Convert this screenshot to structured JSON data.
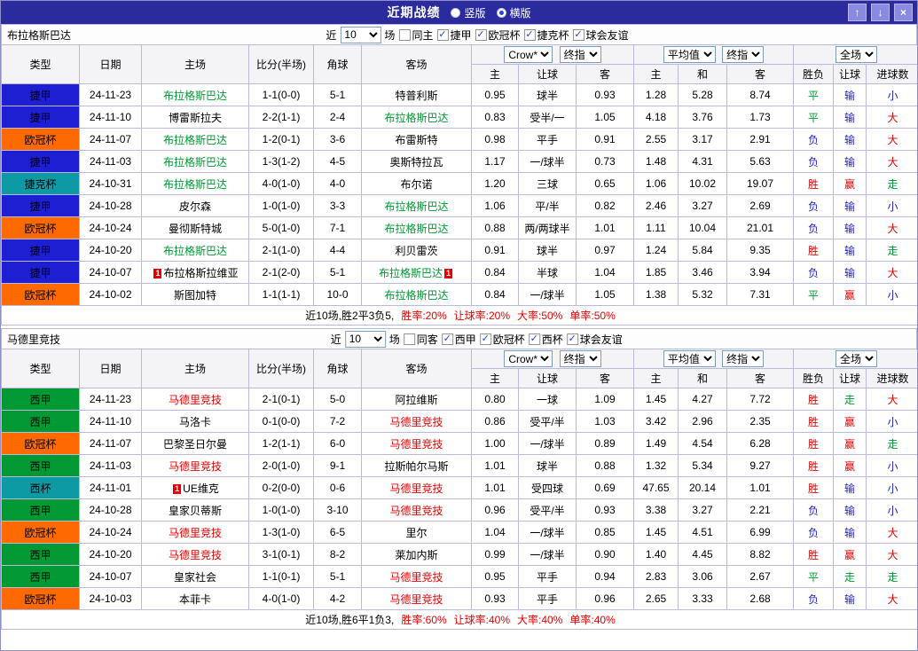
{
  "topbar": {
    "title": "近期战绩",
    "modes": [
      {
        "label": "竖版",
        "selected": false
      },
      {
        "label": "横版",
        "selected": true
      }
    ],
    "up_icon": "↑",
    "down_icon": "↓",
    "close_icon": "×"
  },
  "table_columns": {
    "type": "类型",
    "date": "日期",
    "home": "主场",
    "score": "比分(半场)",
    "corners": "角球",
    "away": "客场",
    "h": "主",
    "handicap": "让球",
    "a": "客",
    "avg_h": "主",
    "draw": "和",
    "avg_a": "客",
    "wl": "胜负",
    "hc": "让球",
    "goals": "进球数",
    "selects": {
      "source": "Crow*",
      "time1": "终指",
      "avg": "平均值",
      "time2": "终指",
      "scope": "全场"
    }
  },
  "colors": {
    "league": {
      "捷甲": "#1e1ed2",
      "欧冠杯": "#ff6a00",
      "捷克杯": "#0d9aa5",
      "西甲": "#009933",
      "西杯": "#0d9aa5"
    },
    "result": {
      "胜": "#e60000",
      "赢": "#e60000",
      "大": "#e60000",
      "平": "#009933",
      "走": "#009933",
      "负": "#2222cc",
      "输": "#2222cc",
      "小": "#2222cc"
    }
  },
  "sections": [
    {
      "team": "布拉格斯巴达",
      "team_color": "#009933",
      "filter": {
        "near_label": "近",
        "games": "10",
        "games_label": "场",
        "same_label": "同主",
        "same_checked": false,
        "leagues": [
          {
            "label": "捷甲",
            "checked": true
          },
          {
            "label": "欧冠杯",
            "checked": true
          },
          {
            "label": "捷克杯",
            "checked": true
          },
          {
            "label": "球会友谊",
            "checked": true
          }
        ]
      },
      "rows": [
        {
          "league": "捷甲",
          "date": "24-11-23",
          "home": {
            "name": "布拉格斯巴达",
            "hl": true
          },
          "score": "1-1(0-0)",
          "corners": "5-1",
          "away": {
            "name": "特普利斯"
          },
          "odds": [
            "0.95",
            "球半",
            "0.93"
          ],
          "avg": [
            "1.28",
            "5.28",
            "8.74"
          ],
          "results": [
            "平",
            "输",
            "小"
          ]
        },
        {
          "league": "捷甲",
          "date": "24-11-10",
          "home": {
            "name": "博雷斯拉夫"
          },
          "score": "2-2(1-1)",
          "corners": "2-4",
          "away": {
            "name": "布拉格斯巴达",
            "hl": true
          },
          "odds": [
            "0.83",
            "受半/一",
            "1.05"
          ],
          "avg": [
            "4.18",
            "3.76",
            "1.73"
          ],
          "results": [
            "平",
            "输",
            "大"
          ]
        },
        {
          "league": "欧冠杯",
          "date": "24-11-07",
          "home": {
            "name": "布拉格斯巴达",
            "hl": true
          },
          "score": "1-2(0-1)",
          "corners": "3-6",
          "away": {
            "name": "布雷斯特"
          },
          "odds": [
            "0.98",
            "平手",
            "0.91"
          ],
          "avg": [
            "2.55",
            "3.17",
            "2.91"
          ],
          "results": [
            "负",
            "输",
            "大"
          ]
        },
        {
          "league": "捷甲",
          "date": "24-11-03",
          "home": {
            "name": "布拉格斯巴达",
            "hl": true
          },
          "score": "1-3(1-2)",
          "corners": "4-5",
          "away": {
            "name": "奥斯特拉瓦"
          },
          "odds": [
            "1.17",
            "一/球半",
            "0.73"
          ],
          "avg": [
            "1.48",
            "4.31",
            "5.63"
          ],
          "results": [
            "负",
            "输",
            "大"
          ]
        },
        {
          "league": "捷克杯",
          "date": "24-10-31",
          "home": {
            "name": "布拉格斯巴达",
            "hl": true
          },
          "score": "4-0(1-0)",
          "corners": "4-0",
          "away": {
            "name": "布尔诺"
          },
          "odds": [
            "1.20",
            "三球",
            "0.65"
          ],
          "avg": [
            "1.06",
            "10.02",
            "19.07"
          ],
          "results": [
            "胜",
            "赢",
            "走"
          ]
        },
        {
          "league": "捷甲",
          "date": "24-10-28",
          "home": {
            "name": "皮尔森"
          },
          "score": "1-0(1-0)",
          "corners": "3-3",
          "away": {
            "name": "布拉格斯巴达",
            "hl": true
          },
          "odds": [
            "1.06",
            "平/半",
            "0.82"
          ],
          "avg": [
            "2.46",
            "3.27",
            "2.69"
          ],
          "results": [
            "负",
            "输",
            "小"
          ]
        },
        {
          "league": "欧冠杯",
          "date": "24-10-24",
          "home": {
            "name": "曼彻斯特城"
          },
          "score": "5-0(1-0)",
          "corners": "7-1",
          "away": {
            "name": "布拉格斯巴达",
            "hl": true
          },
          "odds": [
            "0.88",
            "两/两球半",
            "1.01"
          ],
          "avg": [
            "1.11",
            "10.04",
            "21.01"
          ],
          "results": [
            "负",
            "输",
            "大"
          ]
        },
        {
          "league": "捷甲",
          "date": "24-10-20",
          "home": {
            "name": "布拉格斯巴达",
            "hl": true
          },
          "score": "2-1(1-0)",
          "corners": "4-4",
          "away": {
            "name": "利贝雷茨"
          },
          "odds": [
            "0.91",
            "球半",
            "0.97"
          ],
          "avg": [
            "1.24",
            "5.84",
            "9.35"
          ],
          "results": [
            "胜",
            "输",
            "走"
          ]
        },
        {
          "league": "捷甲",
          "date": "24-10-07",
          "home": {
            "name": "布拉格斯拉维亚",
            "mark_pre": "1"
          },
          "score": "2-1(2-0)",
          "corners": "5-1",
          "away": {
            "name": "布拉格斯巴达",
            "hl": true,
            "mark_post": "1"
          },
          "odds": [
            "0.84",
            "半球",
            "1.04"
          ],
          "avg": [
            "1.85",
            "3.46",
            "3.94"
          ],
          "results": [
            "负",
            "输",
            "大"
          ]
        },
        {
          "league": "欧冠杯",
          "date": "24-10-02",
          "home": {
            "name": "斯图加特"
          },
          "score": "1-1(1-1)",
          "corners": "10-0",
          "away": {
            "name": "布拉格斯巴达",
            "hl": true
          },
          "odds": [
            "0.84",
            "一/球半",
            "1.05"
          ],
          "avg": [
            "1.38",
            "5.32",
            "7.31"
          ],
          "results": [
            "平",
            "赢",
            "小"
          ]
        }
      ],
      "footer": {
        "summary": "近10场,胜2平3负5,",
        "rates": [
          "胜率:20%",
          "让球率:20%",
          "大率:50%",
          "单率:50%"
        ]
      }
    },
    {
      "team": "马德里竞技",
      "team_color": "#e60000",
      "filter": {
        "near_label": "近",
        "games": "10",
        "games_label": "场",
        "same_label": "同客",
        "same_checked": false,
        "leagues": [
          {
            "label": "西甲",
            "checked": true
          },
          {
            "label": "欧冠杯",
            "checked": true
          },
          {
            "label": "西杯",
            "checked": true
          },
          {
            "label": "球会友谊",
            "checked": true
          }
        ]
      },
      "rows": [
        {
          "league": "西甲",
          "date": "24-11-23",
          "home": {
            "name": "马德里竞技",
            "hl": true
          },
          "score": "2-1(0-1)",
          "corners": "5-0",
          "away": {
            "name": "阿拉维斯"
          },
          "odds": [
            "0.80",
            "一球",
            "1.09"
          ],
          "avg": [
            "1.45",
            "4.27",
            "7.72"
          ],
          "results": [
            "胜",
            "走",
            "大"
          ]
        },
        {
          "league": "西甲",
          "date": "24-11-10",
          "home": {
            "name": "马洛卡"
          },
          "score": "0-1(0-0)",
          "corners": "7-2",
          "away": {
            "name": "马德里竞技",
            "hl": true
          },
          "odds": [
            "0.86",
            "受平/半",
            "1.03"
          ],
          "avg": [
            "3.42",
            "2.96",
            "2.35"
          ],
          "results": [
            "胜",
            "赢",
            "小"
          ]
        },
        {
          "league": "欧冠杯",
          "date": "24-11-07",
          "home": {
            "name": "巴黎圣日尔曼"
          },
          "score": "1-2(1-1)",
          "corners": "6-0",
          "away": {
            "name": "马德里竞技",
            "hl": true
          },
          "odds": [
            "1.00",
            "一/球半",
            "0.89"
          ],
          "avg": [
            "1.49",
            "4.54",
            "6.28"
          ],
          "results": [
            "胜",
            "赢",
            "走"
          ]
        },
        {
          "league": "西甲",
          "date": "24-11-03",
          "home": {
            "name": "马德里竞技",
            "hl": true
          },
          "score": "2-0(1-0)",
          "corners": "9-1",
          "away": {
            "name": "拉斯帕尔马斯"
          },
          "odds": [
            "1.01",
            "球半",
            "0.88"
          ],
          "avg": [
            "1.32",
            "5.34",
            "9.27"
          ],
          "results": [
            "胜",
            "赢",
            "小"
          ]
        },
        {
          "league": "西杯",
          "date": "24-11-01",
          "home": {
            "name": "UE维克",
            "mark_pre": "1"
          },
          "score": "0-2(0-0)",
          "corners": "0-6",
          "away": {
            "name": "马德里竞技",
            "hl": true
          },
          "odds": [
            "1.01",
            "受四球",
            "0.69"
          ],
          "avg": [
            "47.65",
            "20.14",
            "1.01"
          ],
          "results": [
            "胜",
            "输",
            "小"
          ]
        },
        {
          "league": "西甲",
          "date": "24-10-28",
          "home": {
            "name": "皇家贝蒂斯"
          },
          "score": "1-0(1-0)",
          "corners": "3-10",
          "away": {
            "name": "马德里竞技",
            "hl": true
          },
          "odds": [
            "0.96",
            "受平/半",
            "0.93"
          ],
          "avg": [
            "3.38",
            "3.27",
            "2.21"
          ],
          "results": [
            "负",
            "输",
            "小"
          ]
        },
        {
          "league": "欧冠杯",
          "date": "24-10-24",
          "home": {
            "name": "马德里竞技",
            "hl": true
          },
          "score": "1-3(1-0)",
          "corners": "6-5",
          "away": {
            "name": "里尔"
          },
          "odds": [
            "1.04",
            "一/球半",
            "0.85"
          ],
          "avg": [
            "1.45",
            "4.51",
            "6.99"
          ],
          "results": [
            "负",
            "输",
            "大"
          ]
        },
        {
          "league": "西甲",
          "date": "24-10-20",
          "home": {
            "name": "马德里竞技",
            "hl": true
          },
          "score": "3-1(0-1)",
          "corners": "8-2",
          "away": {
            "name": "莱加内斯"
          },
          "odds": [
            "0.99",
            "一/球半",
            "0.90"
          ],
          "avg": [
            "1.40",
            "4.45",
            "8.82"
          ],
          "results": [
            "胜",
            "赢",
            "大"
          ]
        },
        {
          "league": "西甲",
          "date": "24-10-07",
          "home": {
            "name": "皇家社会"
          },
          "score": "1-1(0-1)",
          "corners": "5-1",
          "away": {
            "name": "马德里竞技",
            "hl": true
          },
          "odds": [
            "0.95",
            "平手",
            "0.94"
          ],
          "avg": [
            "2.83",
            "3.06",
            "2.67"
          ],
          "results": [
            "平",
            "走",
            "走"
          ]
        },
        {
          "league": "欧冠杯",
          "date": "24-10-03",
          "home": {
            "name": "本菲卡"
          },
          "score": "4-0(1-0)",
          "corners": "4-2",
          "away": {
            "name": "马德里竞技",
            "hl": true
          },
          "odds": [
            "0.93",
            "平手",
            "0.96"
          ],
          "avg": [
            "2.65",
            "3.33",
            "2.68"
          ],
          "results": [
            "负",
            "输",
            "大"
          ]
        }
      ],
      "footer": {
        "summary": "近10场,胜6平1负3,",
        "rates": [
          "胜率:60%",
          "让球率:40%",
          "大率:40%",
          "单率:40%"
        ]
      }
    }
  ]
}
